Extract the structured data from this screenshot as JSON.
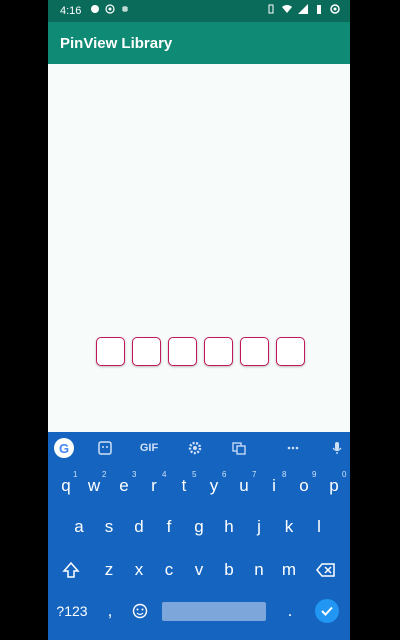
{
  "status_bar": {
    "time": "4:16"
  },
  "app": {
    "title": "PinView Library"
  },
  "pin_view": {
    "box_count": 6,
    "values": [
      "",
      "",
      "",
      "",
      "",
      ""
    ],
    "border_color": "#c2185b"
  },
  "keyboard": {
    "toolbar": {
      "gif_label": "GIF"
    },
    "row1": [
      "q",
      "w",
      "e",
      "r",
      "t",
      "y",
      "u",
      "i",
      "o",
      "p"
    ],
    "row1_hints": [
      "1",
      "2",
      "3",
      "4",
      "5",
      "6",
      "7",
      "8",
      "9",
      "0"
    ],
    "row2": [
      "a",
      "s",
      "d",
      "f",
      "g",
      "h",
      "j",
      "k",
      "l"
    ],
    "row3": [
      "z",
      "x",
      "c",
      "v",
      "b",
      "n",
      "m"
    ],
    "bottom": {
      "symbols_label": "?123",
      "comma": ",",
      "period": "."
    }
  },
  "colors": {
    "status_bar": "#0b6b5b",
    "toolbar": "#0f8a74",
    "keyboard": "#1565c0",
    "enter": "#2196f3"
  }
}
